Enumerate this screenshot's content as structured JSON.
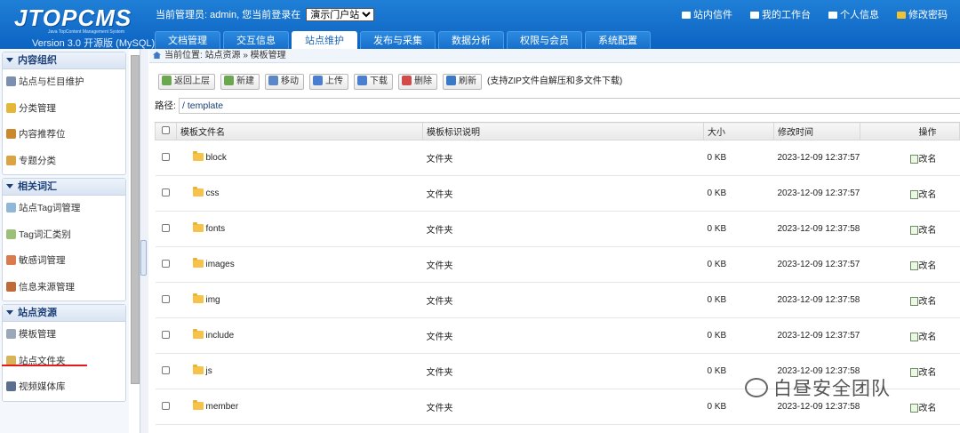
{
  "header": {
    "logo_name": "JTOPCMS",
    "logo_sub": "Java TopContent Management System",
    "version": "Version 3.0 开源版 (MySQL)",
    "admin_prefix": "当前管理员:",
    "admin_name": "admin,",
    "login_prefix": "您当前登录在",
    "site_select": "演示门户站",
    "links": [
      {
        "label": "站内信件",
        "icon": "mail-icon"
      },
      {
        "label": "我的工作台",
        "icon": "workspace-icon"
      },
      {
        "label": "个人信息",
        "icon": "user-icon"
      },
      {
        "label": "修改密码",
        "icon": "key-icon"
      }
    ]
  },
  "nav": {
    "tabs": [
      "文档管理",
      "交互信息",
      "站点维护",
      "发布与采集",
      "数据分析",
      "权限与会员",
      "系统配置"
    ],
    "active": "站点维护"
  },
  "sidebar": {
    "sections": [
      {
        "title": "内容组织",
        "items": [
          {
            "label": "站点与栏目维护",
            "icon": "site-tree-icon",
            "color": "#7b8fb0"
          },
          {
            "label": "分类管理",
            "icon": "category-icon",
            "color": "#e4b73a"
          },
          {
            "label": "内容推荐位",
            "icon": "recommend-icon",
            "color": "#c98a2e"
          },
          {
            "label": "专题分类",
            "icon": "topic-icon",
            "color": "#d9a441"
          }
        ]
      },
      {
        "title": "相关词汇",
        "items": [
          {
            "label": "站点Tag词管理",
            "icon": "tag-icon",
            "color": "#8fb7d8"
          },
          {
            "label": "Tag词汇类别",
            "icon": "tag-category-icon",
            "color": "#9cc07a"
          },
          {
            "label": "敏感词管理",
            "icon": "sensitive-word-icon",
            "color": "#d97b4e"
          },
          {
            "label": "信息来源管理",
            "icon": "source-icon",
            "color": "#c06a3a"
          }
        ]
      },
      {
        "title": "站点资源",
        "items": [
          {
            "label": "模板管理",
            "icon": "template-icon",
            "color": "#9aa8b8"
          },
          {
            "label": "站点文件夹",
            "icon": "site-folder-icon",
            "color": "#d9b25a"
          },
          {
            "label": "视频媒体库",
            "icon": "video-library-icon",
            "color": "#5b6f8f"
          }
        ]
      }
    ]
  },
  "main": {
    "breadcrumb": "当前位置: 站点资源 » 模板管理",
    "toolbar": [
      {
        "label": "返回上层",
        "icon": "back-icon",
        "color": "#6aa84f"
      },
      {
        "label": "新建",
        "icon": "new-icon",
        "color": "#6aa84f"
      },
      {
        "label": "移动",
        "icon": "move-icon",
        "color": "#5b87c9"
      },
      {
        "label": "上传",
        "icon": "upload-icon",
        "color": "#4a7fd0"
      },
      {
        "label": "下载",
        "icon": "download-icon",
        "color": "#4a7fd0"
      },
      {
        "label": "删除",
        "icon": "delete-icon",
        "color": "#d34a4a"
      },
      {
        "label": "刷新",
        "icon": "refresh-icon",
        "color": "#3a78c8"
      }
    ],
    "toolbar_note": "(支持ZIP文件自解压和多文件下载)",
    "path_label": "路径:",
    "path_value": "/ template",
    "columns": [
      "模板文件名",
      "模板标识说明",
      "大小",
      "修改时间",
      "操作"
    ],
    "rows": [
      {
        "name": "block",
        "desc": "文件夹",
        "size": "0 KB",
        "time": "2023-12-09 12:37:57",
        "action": "改名"
      },
      {
        "name": "css",
        "desc": "文件夹",
        "size": "0 KB",
        "time": "2023-12-09 12:37:57",
        "action": "改名"
      },
      {
        "name": "fonts",
        "desc": "文件夹",
        "size": "0 KB",
        "time": "2023-12-09 12:37:58",
        "action": "改名"
      },
      {
        "name": "images",
        "desc": "文件夹",
        "size": "0 KB",
        "time": "2023-12-09 12:37:57",
        "action": "改名"
      },
      {
        "name": "img",
        "desc": "文件夹",
        "size": "0 KB",
        "time": "2023-12-09 12:37:58",
        "action": "改名"
      },
      {
        "name": "include",
        "desc": "文件夹",
        "size": "0 KB",
        "time": "2023-12-09 12:37:57",
        "action": "改名"
      },
      {
        "name": "js",
        "desc": "文件夹",
        "size": "0 KB",
        "time": "2023-12-09 12:37:58",
        "action": "改名"
      },
      {
        "name": "member",
        "desc": "文件夹",
        "size": "0 KB",
        "time": "2023-12-09 12:37:58",
        "action": "改名"
      }
    ]
  },
  "watermark": "白昼安全团队"
}
